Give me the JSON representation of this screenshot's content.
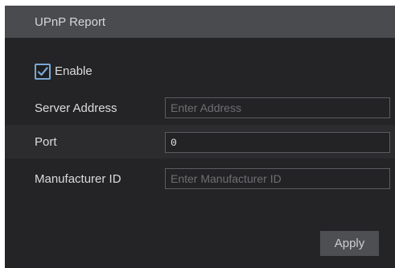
{
  "header": {
    "title": "UPnP Report"
  },
  "enable": {
    "label": "Enable",
    "checked": true
  },
  "fields": {
    "server_address": {
      "label": "Server Address",
      "value": "",
      "placeholder": "Enter Address"
    },
    "port": {
      "label": "Port",
      "value": "0",
      "placeholder": ""
    },
    "manufacturer_id": {
      "label": "Manufacturer ID",
      "value": "",
      "placeholder": "Enter Manufacturer ID"
    }
  },
  "actions": {
    "apply_label": "Apply"
  },
  "colors": {
    "background": "#242426",
    "header": "#4a4b4e",
    "checkbox_accent": "#7aa7d6",
    "button": "#4e4f53"
  }
}
